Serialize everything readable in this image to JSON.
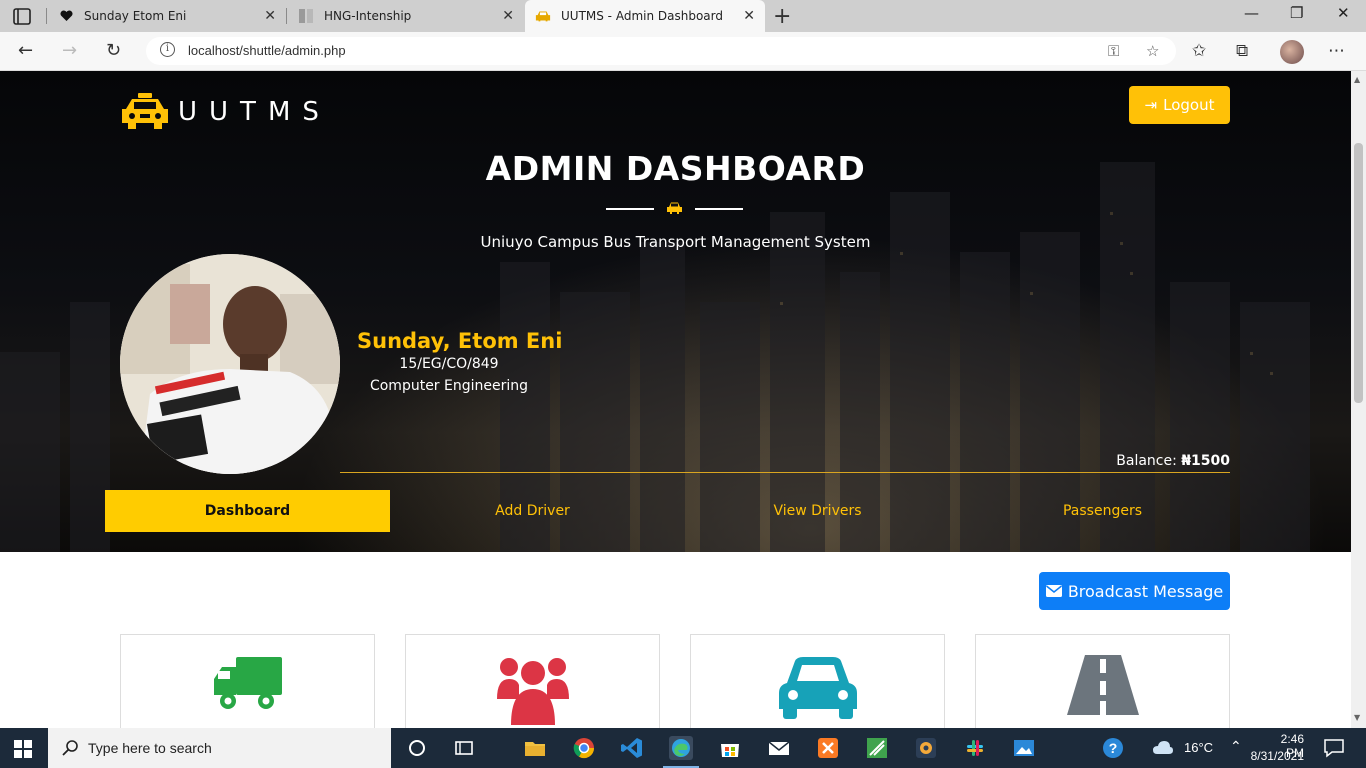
{
  "browser": {
    "tabs": [
      {
        "title": "Sunday Etom Eni",
        "icon": "heart-icon"
      },
      {
        "title": "HNG-Intenship",
        "icon": "hng-icon"
      },
      {
        "title": "UUTMS - Admin Dashboard",
        "icon": "taxi-icon",
        "active": true
      }
    ],
    "url": "localhost/shuttle/admin.php"
  },
  "header": {
    "logo_text": "UUTMS",
    "logout_label": "Logout",
    "title": "ADMIN DASHBOARD",
    "subtitle": "Uniuyo Campus Bus Transport Management System"
  },
  "profile": {
    "name": "Sunday, Etom Eni",
    "id": "15/EG/CO/849",
    "department": "Computer Engineering",
    "balance_label": "Balance:",
    "balance_value": "₦1500"
  },
  "nav": {
    "items": [
      "Dashboard",
      "Add Driver",
      "View Drivers",
      "Passengers"
    ],
    "active": "Dashboard"
  },
  "content": {
    "broadcast_label": "Broadcast Message",
    "cards": [
      {
        "icon": "truck-icon",
        "color": "#28a745"
      },
      {
        "icon": "users-icon",
        "color": "#dc3545"
      },
      {
        "icon": "car-icon",
        "color": "#17a2b8"
      },
      {
        "icon": "road-icon",
        "color": "#6c757d"
      }
    ]
  },
  "taskbar": {
    "search_placeholder": "Type here to search",
    "weather": "16°C",
    "time": "2:46 PM",
    "date": "8/31/2021"
  },
  "colors": {
    "accent": "#ffc107",
    "primary": "#0d7ef7"
  }
}
